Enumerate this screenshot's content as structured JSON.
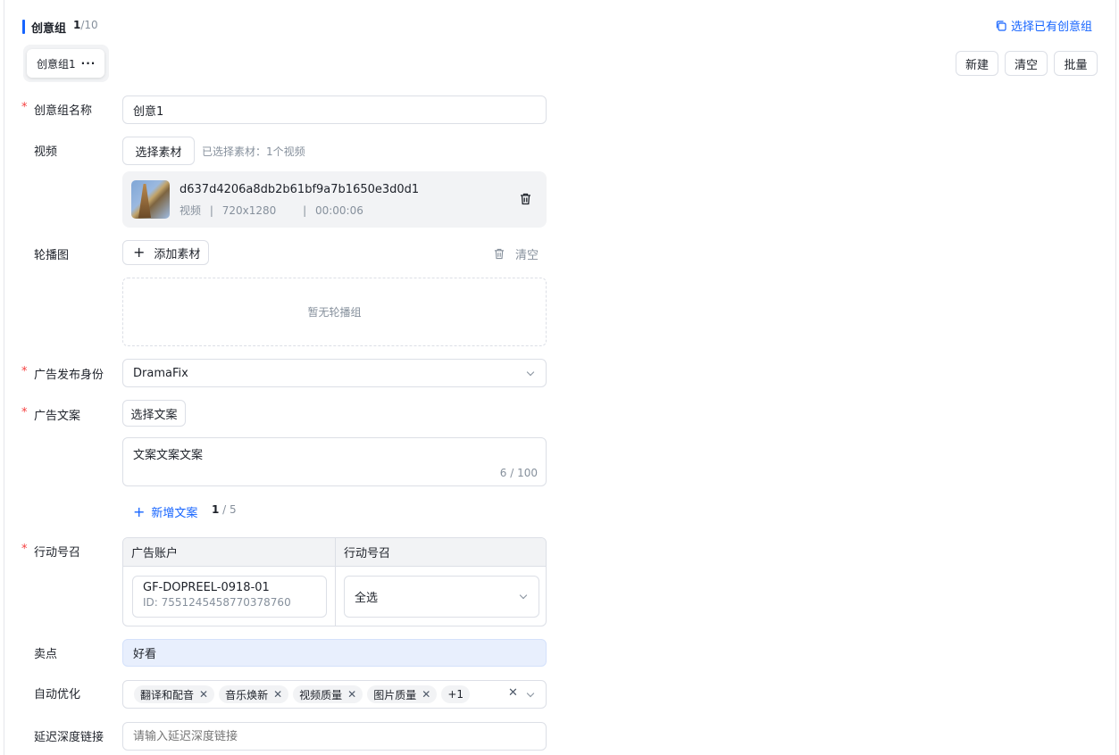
{
  "section": {
    "title": "创意组",
    "count_current": "1",
    "count_total": "/10",
    "select_existing_link": "选择已有创意组"
  },
  "tabs": [
    {
      "label": "创意组1",
      "more": "···"
    }
  ],
  "toolbar": {
    "new_label": "新建",
    "clear_label": "清空",
    "batch_label": "批量"
  },
  "form": {
    "required_mark": "*",
    "group_name": {
      "label": "创意组名称",
      "value": "创意1"
    },
    "video": {
      "label": "视频",
      "select_button": "选择素材",
      "selected_info": "已选择素材：1个视频",
      "item": {
        "name": "d637d4206a8db2b61bf9a7b1650e3d0d1",
        "type": "视频",
        "resolution": "720x1280",
        "duration": "00:00:06",
        "separator": "|"
      }
    },
    "carousel": {
      "label": "轮播图",
      "add_button": "添加素材",
      "clear_label": "清空",
      "empty_text": "暂无轮播组"
    },
    "publisher": {
      "label": "广告发布身份",
      "value": "DramaFix"
    },
    "copy": {
      "label": "广告文案",
      "select_button": "选择文案",
      "text": "文案文案文案",
      "counter": "6 / 100",
      "add_link": "新增文案",
      "add_count_current": "1",
      "add_count_total": " / 5"
    },
    "cta": {
      "label": "行动号召",
      "col_account": "广告账户",
      "col_cta": "行动号召",
      "account_name": "GF-DOPREEL-0918-01",
      "account_id": "ID: 7551245458770378760",
      "cta_value": "全选"
    },
    "selling_point": {
      "label": "卖点",
      "value": "好看"
    },
    "auto_optimize": {
      "label": "自动优化",
      "tags": [
        "翻译和配音",
        "音乐焕新",
        "视频质量",
        "图片质量"
      ],
      "more_tag": "+1"
    },
    "deeplink": {
      "label": "延迟深度链接",
      "placeholder": "请输入延迟深度链接"
    }
  }
}
